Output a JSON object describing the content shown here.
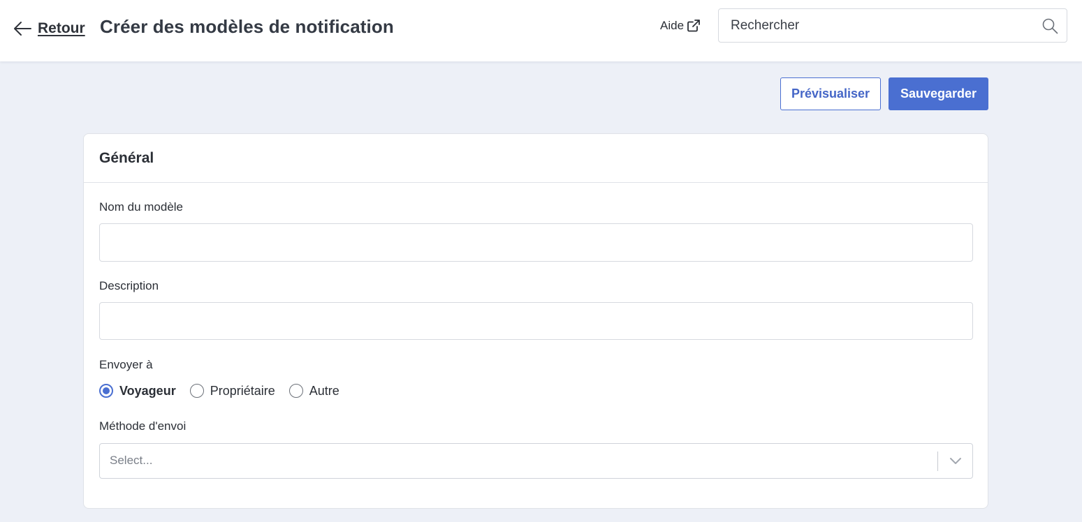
{
  "header": {
    "back_label": "Retour",
    "title": "Créer des modèles de notification",
    "help_label": "Aide",
    "search_placeholder": "Rechercher"
  },
  "actions": {
    "preview_label": "Prévisualiser",
    "save_label": "Sauvegarder"
  },
  "card": {
    "title": "Général",
    "fields": {
      "template_name": {
        "label": "Nom du modèle",
        "value": ""
      },
      "description": {
        "label": "Description",
        "value": ""
      },
      "send_to": {
        "label": "Envoyer à",
        "options": [
          {
            "label": "Voyageur",
            "selected": true
          },
          {
            "label": "Propriétaire",
            "selected": false
          },
          {
            "label": "Autre",
            "selected": false
          }
        ]
      },
      "send_method": {
        "label": "Méthode d'envoi",
        "placeholder": "Select..."
      }
    }
  },
  "colors": {
    "accent": "#4a6fd1",
    "background": "#edf0f7",
    "card": "#ffffff",
    "text": "#2b2f36"
  }
}
